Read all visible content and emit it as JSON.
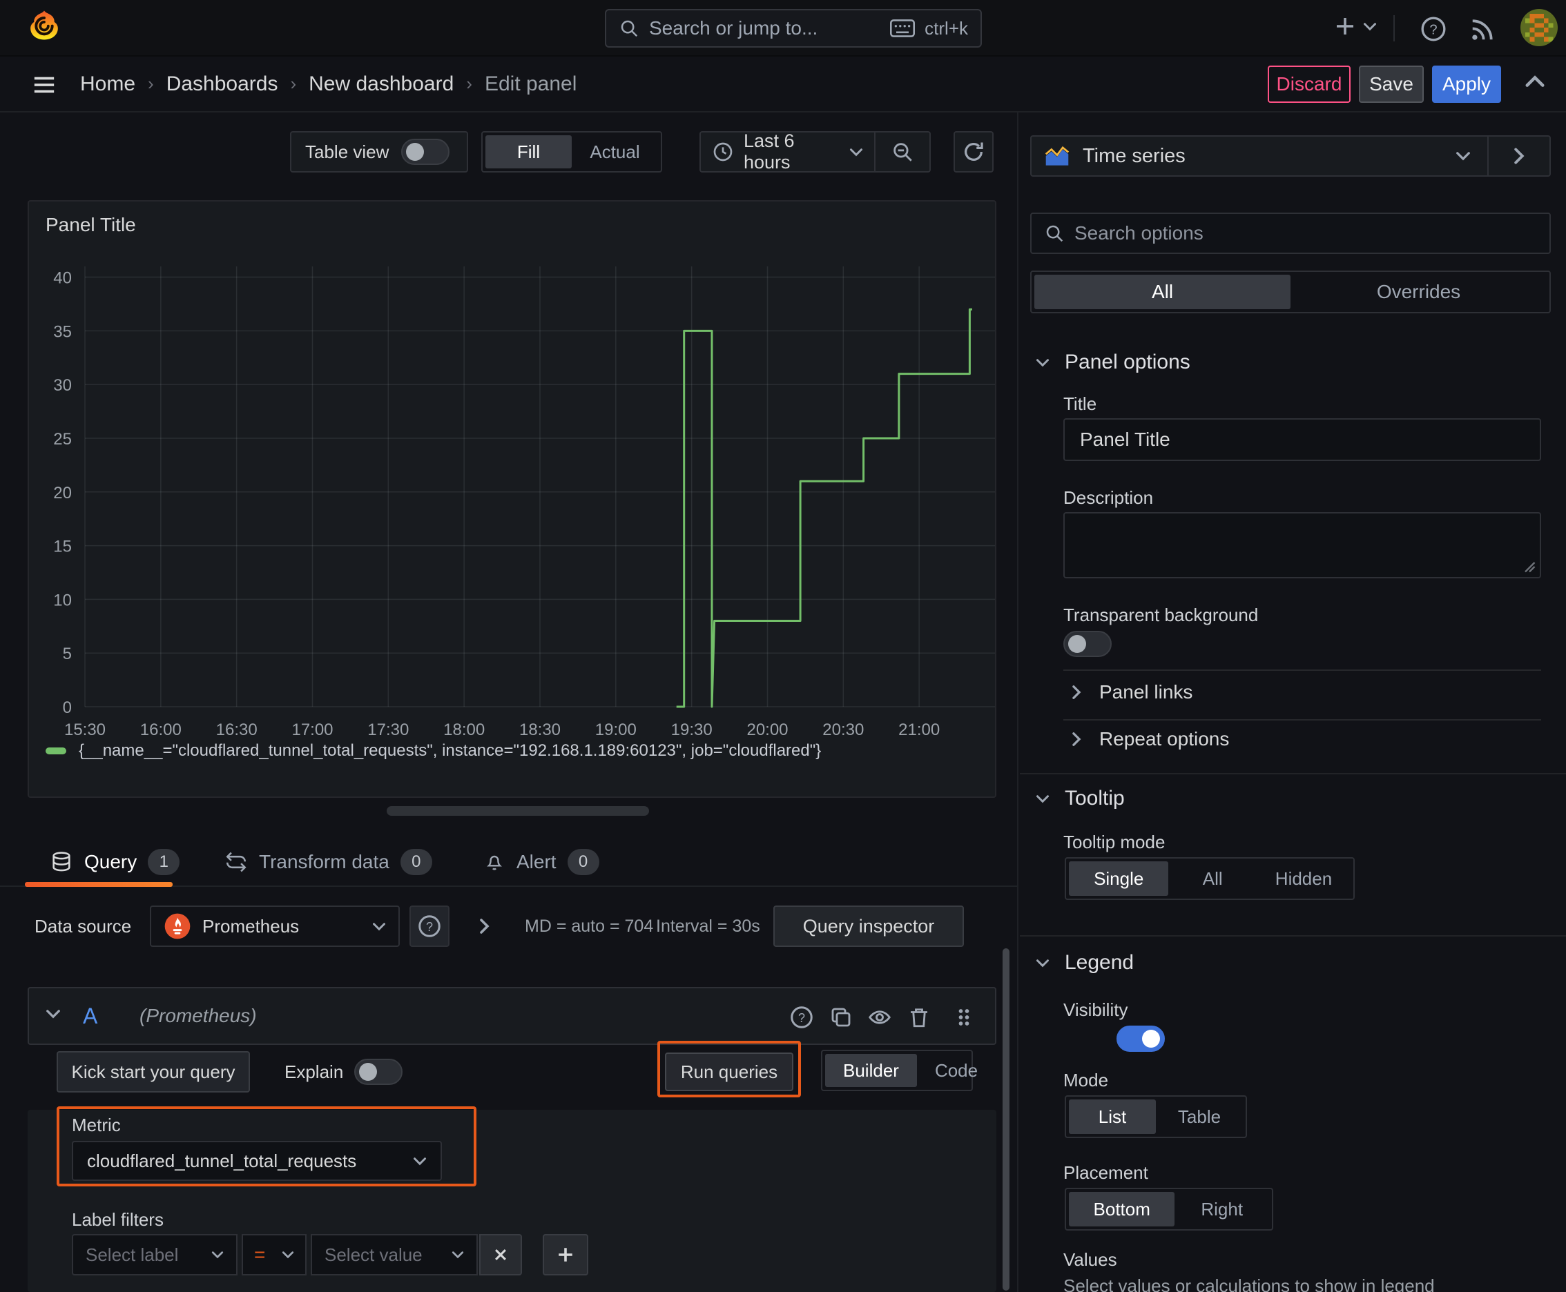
{
  "colors": {
    "accent_blue": "#3d71d9",
    "annotation_orange": "#e8591a",
    "discard_pink": "#ff5286",
    "series_green": "#73bf69",
    "ref_id_blue": "#5794f2",
    "tab_underline_from": "#f05a28",
    "tab_underline_to": "#f8852c"
  },
  "topbar": {
    "search_placeholder": "Search or jump to...",
    "shortcut": "ctrl+k"
  },
  "breadcrumb": {
    "items": [
      "Home",
      "Dashboards",
      "New dashboard",
      "Edit panel"
    ]
  },
  "actions": {
    "discard": "Discard",
    "save": "Save",
    "apply": "Apply"
  },
  "panel_toolbar": {
    "table_view": "Table view",
    "fill": "Fill",
    "actual": "Actual",
    "time_range": "Last 6 hours"
  },
  "panel": {
    "title": "Panel Title"
  },
  "chart_data": {
    "type": "line",
    "step": true,
    "title": "Panel Title",
    "xlabel": "",
    "ylabel": "",
    "x_range": [
      "15:30",
      "21:30"
    ],
    "x_ticks": [
      "15:30",
      "16:00",
      "16:30",
      "17:00",
      "17:30",
      "18:00",
      "18:30",
      "19:00",
      "19:30",
      "20:00",
      "20:30",
      "21:00"
    ],
    "y_ticks": [
      0,
      5,
      10,
      15,
      20,
      25,
      30,
      35,
      40
    ],
    "ylim": [
      0,
      41
    ],
    "grid": true,
    "legend_position": "bottom",
    "series": [
      {
        "name": "{__name__=\"cloudflared_tunnel_total_requests\", instance=\"192.168.1.189:60123\", job=\"cloudflared\"}",
        "color": "#73bf69",
        "points": [
          [
            "19:24",
            0
          ],
          [
            "19:27",
            0
          ],
          [
            "19:27",
            35
          ],
          [
            "19:38",
            35
          ],
          [
            "19:38",
            0
          ],
          [
            "19:39",
            8
          ],
          [
            "20:13",
            8
          ],
          [
            "20:13",
            21
          ],
          [
            "20:38",
            21
          ],
          [
            "20:38",
            25
          ],
          [
            "20:52",
            25
          ],
          [
            "20:52",
            31
          ],
          [
            "21:20",
            31
          ],
          [
            "21:20",
            37
          ],
          [
            "21:21",
            37
          ]
        ]
      }
    ]
  },
  "query_tabs": [
    {
      "label": "Query",
      "count": "1"
    },
    {
      "label": "Transform data",
      "count": "0"
    },
    {
      "label": "Alert",
      "count": "0"
    }
  ],
  "datasource": {
    "label": "Data source",
    "name": "Prometheus",
    "max_data_points": "MD = auto = 704",
    "interval": "Interval = 30s",
    "inspector": "Query inspector"
  },
  "query": {
    "ref_id": "A",
    "datasource_hint": "(Prometheus)",
    "kickstart": "Kick start your query",
    "explain": "Explain",
    "run": "Run queries",
    "builder": "Builder",
    "code": "Code",
    "metric_label": "Metric",
    "metric_value": "cloudflared_tunnel_total_requests",
    "label_filters": "Label filters",
    "select_label": "Select label",
    "operator": "=",
    "select_value": "Select value"
  },
  "options": {
    "viz_type": "Time series",
    "search_placeholder": "Search options",
    "filter_tabs": {
      "all": "All",
      "overrides": "Overrides"
    },
    "panel_options": {
      "heading": "Panel options",
      "title_label": "Title",
      "title_value": "Panel Title",
      "description_label": "Description",
      "transparent_label": "Transparent background"
    },
    "links": {
      "panel_links": "Panel links",
      "repeat_options": "Repeat options"
    },
    "tooltip": {
      "heading": "Tooltip",
      "mode_label": "Tooltip mode",
      "modes": [
        "Single",
        "All",
        "Hidden"
      ],
      "selected": "Single"
    },
    "legend": {
      "heading": "Legend",
      "visibility_label": "Visibility",
      "mode_label": "Mode",
      "modes": [
        "List",
        "Table"
      ],
      "selected_mode": "List",
      "placement_label": "Placement",
      "placements": [
        "Bottom",
        "Right"
      ],
      "selected_placement": "Bottom",
      "values_label": "Values",
      "values_help": "Select values or calculations to show in legend"
    }
  }
}
